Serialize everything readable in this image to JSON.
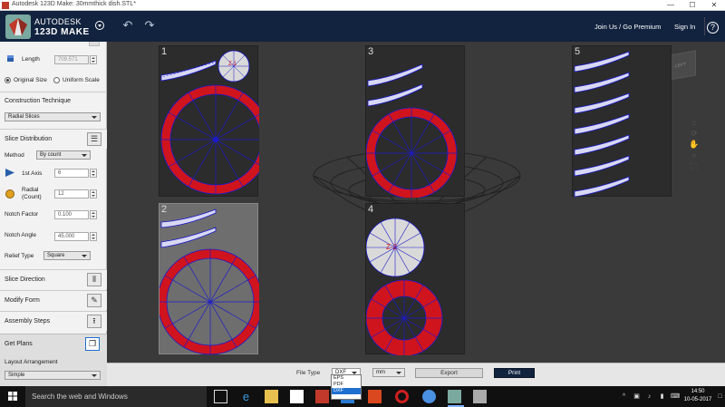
{
  "window": {
    "title": "Autodesk 123D Make: 30mmthick dish.STL*",
    "minimize": "—",
    "maximize": "☐",
    "close": "✕"
  },
  "app": {
    "brand_line1": "AUTODESK",
    "brand_line2": "123D MAKE",
    "join_us": "Join Us / Go Premium",
    "sign_in": "Sign In",
    "help": "?",
    "undo_icon": "undo-arrow-icon",
    "redo_icon": "redo-arrow-icon"
  },
  "panel": {
    "length_label": "Length",
    "length_value": "709.571",
    "original_size": "Original Size",
    "uniform_scale": "Uniform Scale",
    "construction_technique_label": "Construction Technique",
    "construction_technique_value": "Radial Slices",
    "slice_distribution_label": "Slice Distribution",
    "method_label": "Method",
    "method_value": "By count",
    "first_axis_label": "1st Axis",
    "first_axis_value": "6",
    "radial_label_1": "Radial",
    "radial_label_2": "(Count)",
    "radial_value": "12",
    "notch_factor_label": "Notch Factor",
    "notch_factor_value": "0.100",
    "notch_angle_label": "Notch Angle",
    "notch_angle_value": "45.000",
    "relief_type_label": "Relief Type",
    "relief_type_value": "Square",
    "slice_direction": "Slice Direction",
    "modify_form": "Modify Form",
    "assembly_steps": "Assembly Steps",
    "get_plans": "Get Plans",
    "layout_arrangement_label": "Layout Arrangement",
    "layout_arrangement_value": "Simple"
  },
  "sheets": [
    {
      "num": "1"
    },
    {
      "num": "2"
    },
    {
      "num": "3"
    },
    {
      "num": "4"
    },
    {
      "num": "5"
    }
  ],
  "part_labels": {
    "z1": "Z-1",
    "z2": "Z-2"
  },
  "viewcube": {
    "face": "LEFT"
  },
  "bottom": {
    "file_type_label": "File Type",
    "file_type_value": "DXF",
    "unit_value": "mm",
    "export": "Export",
    "print": "Print",
    "file_type_options": [
      "EPS",
      "PDF",
      "DXF"
    ]
  },
  "taskbar": {
    "search_placeholder": "Search the web and Windows",
    "time": "14:50",
    "date": "10-05-2017"
  },
  "colors": {
    "appbar": "#12233f",
    "ring_red": "#d0141e",
    "slice_blue": "#1a1acc",
    "accent_blue": "#1f6fd0"
  }
}
